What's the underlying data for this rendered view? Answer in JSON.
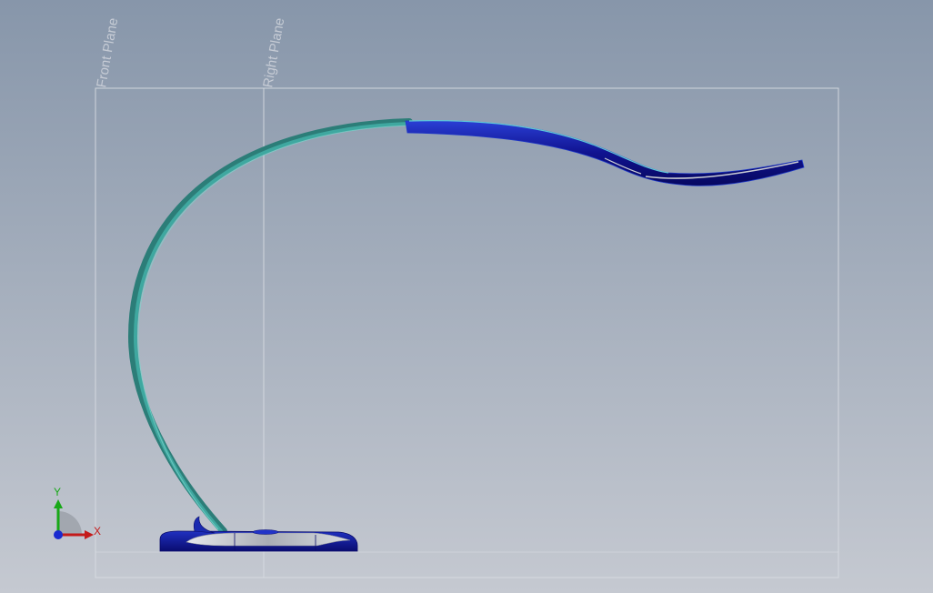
{
  "viewport": {
    "background_top": "#8796aa",
    "background_bottom": "#c5c9d1",
    "plane_color": "#d8dce2"
  },
  "planes": {
    "front": {
      "label": "Front Plane"
    },
    "right": {
      "label": "Right Plane"
    }
  },
  "model": {
    "arm_color": "#3fa8a0",
    "arm_shadow": "#2c7d78",
    "head_color": "#10128f",
    "head_edge": "#1f39c8",
    "base_color": "#14168a",
    "base_top": "#b8bcc4"
  },
  "triad": {
    "y_label": "Y",
    "x_label": "X",
    "y_color": "#18a818",
    "x_color": "#c41a1a",
    "z_color": "#1a2ad0",
    "icons": [
      "y-axis-arrow-icon",
      "x-axis-arrow-icon",
      "z-axis-dot-icon"
    ]
  }
}
